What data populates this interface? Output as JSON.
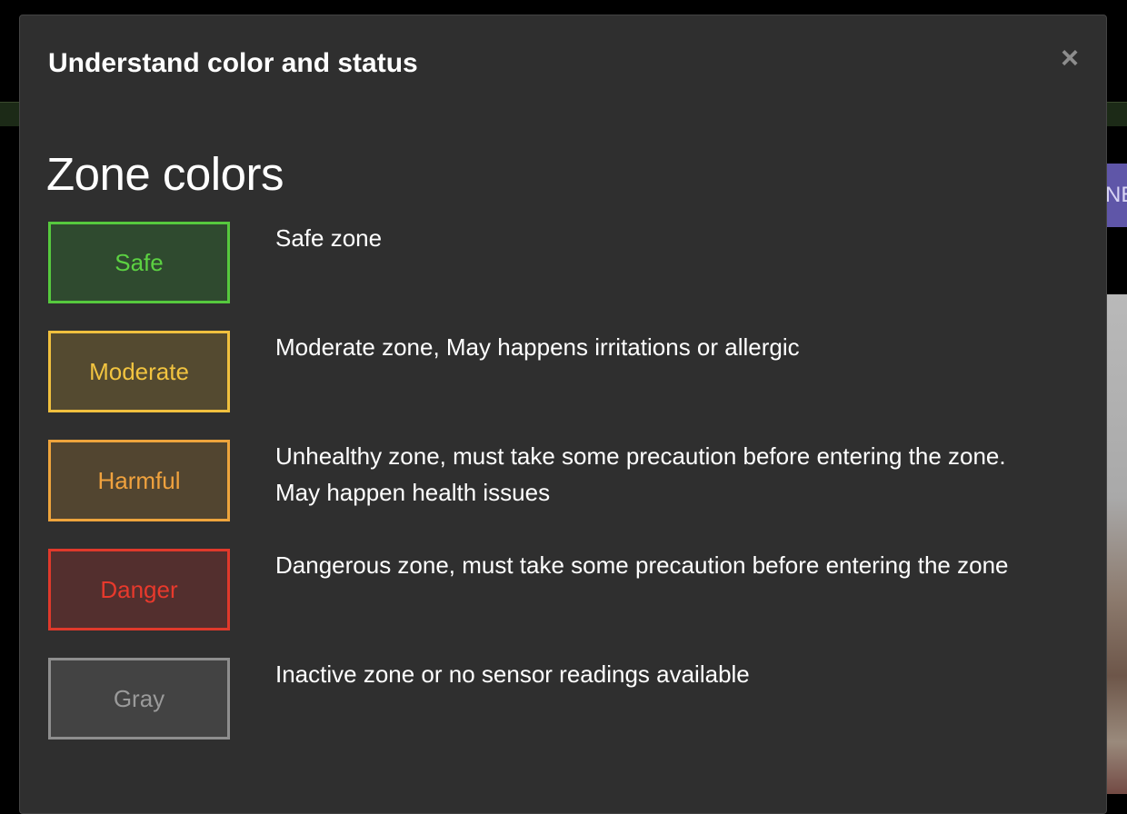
{
  "background": {
    "partial_button_text": "NE"
  },
  "modal": {
    "title": "Understand color and status",
    "close_label": "×",
    "section_heading": "Zone colors",
    "zones": [
      {
        "label": "Safe",
        "description": "Safe zone",
        "text_color": "#5cd142",
        "border_color": "#56c93e",
        "fill_color": "#2f4a2f"
      },
      {
        "label": "Moderate",
        "description": "Moderate zone, May happens irritations or allergic",
        "text_color": "#f2c440",
        "border_color": "#f0c03e",
        "fill_color": "#544a30"
      },
      {
        "label": "Harmful",
        "description": "Unhealthy zone, must take some precaution before entering the zone. May happen health issues",
        "text_color": "#f0a23e",
        "border_color": "#eea43c",
        "fill_color": "#524530"
      },
      {
        "label": "Danger",
        "description": "Dangerous zone, must take some precaution before entering the zone",
        "text_color": "#e8392c",
        "border_color": "#e0392b",
        "fill_color": "#532f2e"
      },
      {
        "label": "Gray",
        "description": "Inactive zone or no sensor readings available",
        "text_color": "#9a9a9a",
        "border_color": "#8e8e8e",
        "fill_color": "#434343"
      }
    ]
  }
}
